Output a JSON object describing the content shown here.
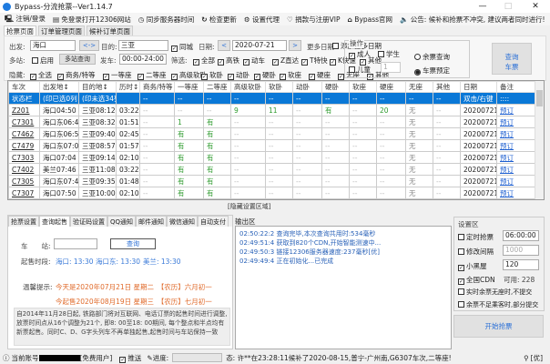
{
  "window": {
    "title": "Bypass-分流抢票--Ver1.14.7",
    "minimize": "—",
    "maximize": "□",
    "close": "✕"
  },
  "toolbar": [
    {
      "icon": "🖳",
      "label": "注销/登录"
    },
    {
      "icon": "▤",
      "label": "免登录打开12306网站"
    },
    {
      "icon": "◷",
      "label": "同步服务器时间"
    },
    {
      "icon": "↻",
      "label": "检查更新"
    },
    {
      "icon": "⚙",
      "label": "设置代理"
    },
    {
      "icon": "♡",
      "label": "捐款与注册VIP"
    },
    {
      "icon": "⌂",
      "label": "Bypass官网"
    },
    {
      "icon": "🔈",
      "label": "公告: 候补和抢票不冲突, 建议两者同时进行!"
    }
  ],
  "tabs": [
    "抢票页面",
    "订单管理页面",
    "候补订单页面"
  ],
  "query": {
    "from_label": "出发:",
    "from_value": "海口",
    "swap": "<->",
    "to_label": "目的:",
    "to_value": "三亚",
    "same_city": "同城",
    "date_label": "日期:",
    "prev": "<",
    "date_value": "2020-07-21",
    "next": ">",
    "more_dates_label": "更多日期:",
    "add_dates": "添加更多日期",
    "multi_label": "多站:",
    "multi_enable": "启用",
    "multi_query": "多站查询",
    "depart_label": "发车:",
    "depart_value": "00:00-24:00",
    "filter_label": "筛选:",
    "filters": [
      "全部",
      "高铁",
      "动车",
      "Z直达",
      "T特快",
      "K快速",
      "其他"
    ],
    "hide_label": "隐藏:",
    "hides": [
      "全选",
      "商务/特等",
      "一等座",
      "二等座",
      "高级软卧",
      "软卧",
      "动卧",
      "硬卧",
      "软座",
      "硬座",
      "无座",
      "其他"
    ]
  },
  "operation": {
    "title": "操作",
    "adult": "成人",
    "student": "学生",
    "child": "儿童",
    "child_count": "1",
    "radio_rest": "余票查询",
    "radio_book": "车票预定",
    "query_button": "查询车票"
  },
  "table": {
    "headers": [
      "车次",
      "出发地↕",
      "目的地↕",
      "历时↕",
      "商务/特等",
      "一等座",
      "二等座",
      "高级软卧",
      "软卧",
      "动卧",
      "硬卧",
      "软座",
      "硬座",
      "无座",
      "其他",
      "日期",
      "备注"
    ],
    "status_row": [
      "状态栏",
      "(印已选0列",
      "(印未选34列",
      "",
      "--",
      "--",
      "--",
      "--",
      "--",
      "--",
      "--",
      "--",
      "--",
      "--",
      "--",
      "双击/右键",
      "::::"
    ],
    "rows": [
      [
        "Z201",
        "海口04:50",
        "三亚08:12",
        "03:22",
        "--",
        "--",
        "--",
        "9",
        "11",
        "--",
        "有",
        "--",
        "20",
        "无",
        "--",
        "20200721",
        "预订"
      ],
      [
        "C7301",
        "海口东06:41",
        "三亚08:32",
        "01:51",
        "--",
        "1",
        "有",
        "--",
        "--",
        "--",
        "--",
        "--",
        "--",
        "无",
        "--",
        "20200721",
        "预订"
      ],
      [
        "C7462",
        "海口东06:55",
        "三亚09:40",
        "02:45",
        "--",
        "有",
        "有",
        "--",
        "--",
        "--",
        "--",
        "--",
        "--",
        "无",
        "--",
        "20200721",
        "预订"
      ],
      [
        "C7479",
        "海口东07:00",
        "三亚08:57",
        "01:57",
        "--",
        "有",
        "有",
        "--",
        "--",
        "--",
        "--",
        "--",
        "--",
        "无",
        "--",
        "20200721",
        "预订"
      ],
      [
        "C7303",
        "海口07:04",
        "三亚09:14",
        "02:10",
        "--",
        "有",
        "有",
        "--",
        "--",
        "--",
        "--",
        "--",
        "--",
        "无",
        "--",
        "20200721",
        "预订"
      ],
      [
        "C7402",
        "美兰07:46",
        "三亚11:08",
        "03:22",
        "--",
        "有",
        "有",
        "--",
        "--",
        "--",
        "--",
        "--",
        "--",
        "无",
        "--",
        "20200721",
        "预订"
      ],
      [
        "C7305",
        "海口东07:47",
        "三亚09:35",
        "01:48",
        "--",
        "有",
        "有",
        "--",
        "--",
        "--",
        "--",
        "--",
        "--",
        "无",
        "--",
        "20200721",
        "预订"
      ],
      [
        "C7307",
        "海口07:50",
        "三亚10:00",
        "02:10",
        "--",
        "有",
        "有",
        "--",
        "--",
        "--",
        "--",
        "--",
        "--",
        "无",
        "--",
        "20200721",
        "预订"
      ]
    ]
  },
  "hide_settings": "[隐藏设置区域]",
  "left_tabs": [
    "抢票设置",
    "查询起售",
    "验证码设置",
    "QQ通知",
    "邮件通知",
    "微信通知",
    "自动支付"
  ],
  "presale": {
    "train_label": "车　　站:",
    "train_value": "",
    "query_button": "查询",
    "time_label": "起售时段:",
    "times": [
      "海口: 13:30",
      "海口东: 13:30",
      "美兰: 13:30"
    ],
    "tip_label": "温馨提示:",
    "tip1": "今天是2020年07月21日 星期二　【农历】六月初一",
    "tip2": "今起售2020年08月19日 星期三　【农历】七月初一",
    "notice": "自2014年11月28日起, 铁路部门将对互联网、电话订票的起售时间进行调整, 放票时间点从16个调整为21个, 即8: 00至18: 00期间, 每个整点和半点均有新票起售。同时C、D、G字头列车不再单独起售,起售时间与车站保持一致"
  },
  "output": {
    "title": "输出区",
    "lines": [
      "02:50:22:2  查询完毕,本次查询共用时:534毫秒",
      "02:49:51:4  获取到820个CDN,开始智能测速中...",
      "02:49:50:3  链接12306服务器速度:237毫秒[优]",
      "02:49:49:4  正在初始化...已完成"
    ]
  },
  "settings": {
    "title": "设置区",
    "timed": "定时抢票",
    "timed_value": "06:00:00",
    "interval": "修改间隔",
    "interval_value": "1000",
    "small_black": "小黑屋",
    "small_black_value": "120",
    "cdn": "全国CDN",
    "cdn_avail": "可用: 228",
    "opt1": "实时余票无座时,不提交",
    "opt2": "余票不足乘客时,部分提交",
    "start": "开始抢票"
  },
  "status": {
    "account_label": "当前账号",
    "user_type": "[免费用户]",
    "push": "推送",
    "progress_label": "进度:",
    "progress": 0,
    "dynamic": "态: 许**在23:28:11候补了2020-08-15,普宁-广州南,G6307车次,二等座!",
    "quality": "[优]"
  }
}
